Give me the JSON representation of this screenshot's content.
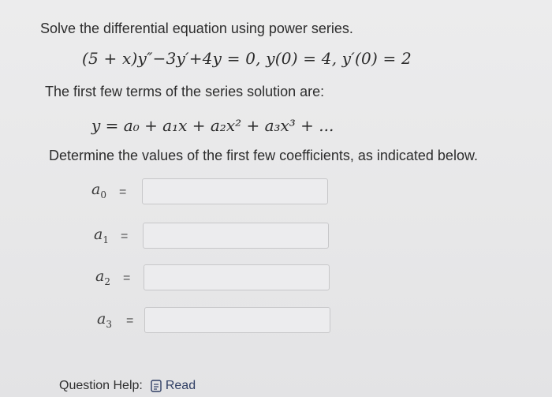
{
  "question": {
    "prompt": "Solve the differential equation using power series.",
    "equation": "(5 + x)y″−3y′+4y = 0,  y(0) = 4,  y′(0) = 2",
    "series_prompt": "The first few terms of the series solution are:",
    "series": "y = a₀ + a₁x + a₂x² + a₃x³ + ...",
    "determine": "Determine the values of the first few coefficients, as indicated below."
  },
  "coefficients": [
    {
      "label": "a",
      "sub": "0",
      "equals": "=",
      "value": ""
    },
    {
      "label": "a",
      "sub": "1",
      "equals": "=",
      "value": ""
    },
    {
      "label": "a",
      "sub": "2",
      "equals": "=",
      "value": ""
    },
    {
      "label": "a",
      "sub": "3",
      "equals": "=",
      "value": ""
    }
  ],
  "help": {
    "label": "Question Help:",
    "read_label": "Read"
  },
  "icons": {
    "read": "document-icon"
  }
}
